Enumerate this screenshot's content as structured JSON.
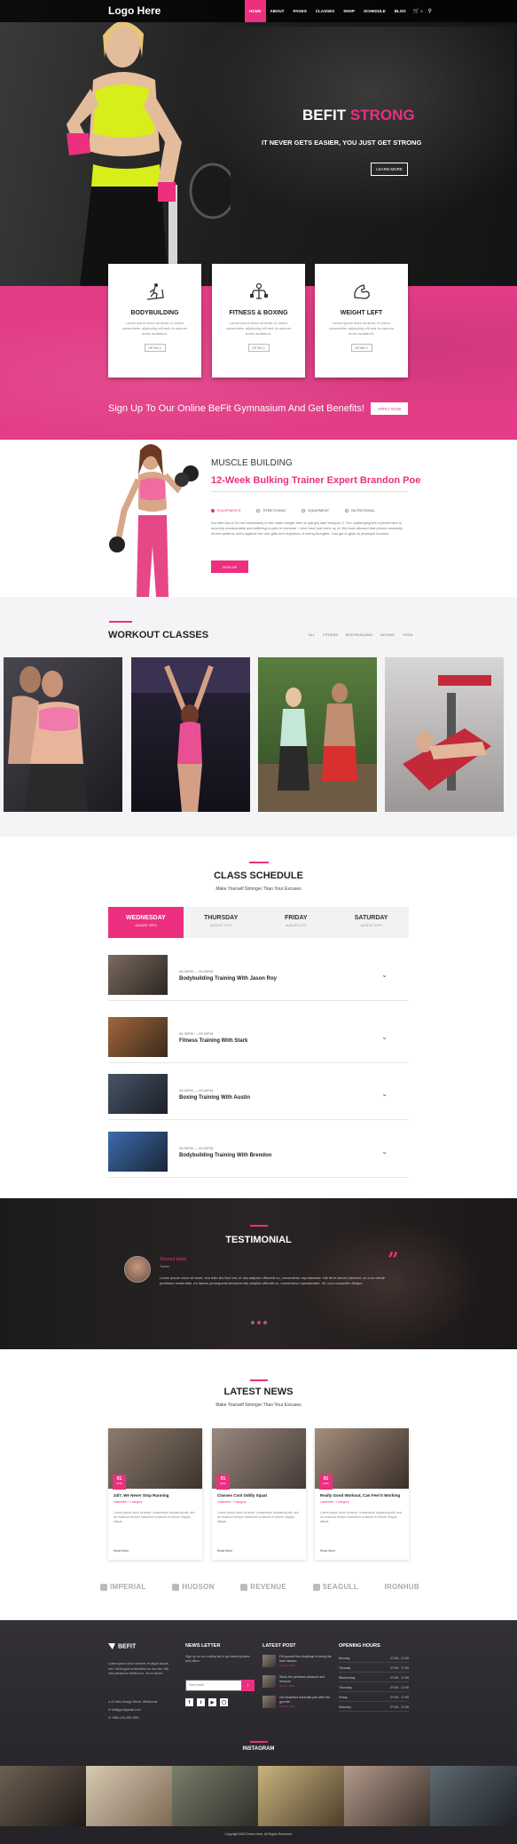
{
  "header": {
    "logo": "Logo Here",
    "nav": [
      "HOME",
      "ABOUT",
      "PAGES",
      "CLASSES",
      "SHOP",
      "SCHEDULE",
      "BLOG"
    ],
    "cart_count": "0"
  },
  "hero": {
    "title_white": "BEFIT ",
    "title_pink": "STRONG",
    "subtitle": "IT NEVER GETS EASIER, YOU JUST GET STRONG",
    "button": "LEARN MORE"
  },
  "services": [
    {
      "icon": "treadmill-icon",
      "title": "BODYBUILDING",
      "text": "Lorem ipsum dolor sit amet, in emico consectetur adipiscing elit sed do sacrum emitu incididunt.",
      "button": "DETAILS"
    },
    {
      "icon": "boxing-icon",
      "title": "FITNESS & BOXING",
      "text": "Lorem ipsum dolor sit amet, in emico consectetur adipiscing elit sed do sacrum emitu incididunt.",
      "button": "DETAILS"
    },
    {
      "icon": "bicep-icon",
      "title": "WEIGHT LEFT",
      "text": "Lorem ipsum dolor sit amet, in emico consectetur adipiscing elit sed do sacrum emitu incididunt.",
      "button": "DETAILS"
    }
  ],
  "signup": {
    "text": "Sign Up To Our Online BeFit Gymnasium And Get Benefits!",
    "button": "APPLY NOW"
  },
  "muscle": {
    "title": "MUSCLE BUILDING",
    "subtitle": "12-Week Bulking Trainer Expert Brandon Poe",
    "tabs": [
      "EQUIPMENTS",
      "STRETCHING",
      "EQUIPMENT",
      "NUTRITIONAL"
    ],
    "text": "Est idhe Amos it's not necessarily to the under weight aren is a(anys) said Weapon 3. The challenging the a period who is severely uneasonable and suffering is pain to exercise + who have just been up in. We have allowed that person modestly renew systems one's against her own gifts and regimens of wrong thoughts. Just get in glute to physique function.",
    "button": "SIGN UP"
  },
  "workout": {
    "title": "WORKOUT CLASSES",
    "filters": [
      "ALL",
      "FITNESS",
      "BODYBUILDING",
      "BOXING",
      "YOGA"
    ]
  },
  "schedule": {
    "title": "CLASS SCHEDULE",
    "subtitle": "Make Yourself Stronger Than Your Excuses",
    "days": [
      {
        "name": "WEDNESDAY",
        "date": "AUGUST 09TH"
      },
      {
        "name": "THURSDAY",
        "date": "AUGUST 10TH"
      },
      {
        "name": "FRIDAY",
        "date": "AUGUST 11TH"
      },
      {
        "name": "SATURDAY",
        "date": "AUGUST 12TH"
      }
    ],
    "items": [
      {
        "time": "08.30PM — 09.30PM",
        "name": "Bodybuilding Training With Jason Roy"
      },
      {
        "time": "08.30PM — 09.30PM",
        "name": "Fitness Training With Stark"
      },
      {
        "time": "08.30PM — 09.30PM",
        "name": "Boxing Training With Austin"
      },
      {
        "time": "08.30PM — 09.30PM",
        "name": "Bodybuilding Training With Brendon"
      }
    ]
  },
  "testimonial": {
    "title": "TESTIMONIAL",
    "name": "Sriemul Islam",
    "role": "Trainer",
    "text": "Lorem ipsum dolor sit amet, sed ddlo ten illud est, et vitu adipisci officendi vu, consectetur repudiandae. Nik ferrn labore placerat, ou cum virtute pertinaxu sententiae, ea labore persequeris tincidunt vitu adipisci offendit vu, consectetur repudiandae. Vii, cum coopertim tibique."
  },
  "news": {
    "title": "LATEST NEWS",
    "subtitle": "Make Yourself Stronger Than Your Excuses",
    "posts": [
      {
        "day": "01",
        "month": "AUG",
        "title": "24/7, We Never Stop Running",
        "author": "Lawmeter",
        "cat": "Category",
        "text": "Lorem ipsum dolor sit amet, consectetur adipiscing elit, sed do eiusmod tempor incididunt ut labore et dolore magna aliqua.",
        "more": "Read More"
      },
      {
        "day": "01",
        "month": "AUG",
        "title": "Classes Cool Oddly Squat",
        "author": "Lawmeter",
        "cat": "Category",
        "text": "Lorem ipsum dolor sit amet, consectetur adipiscing elit, sed do eiusmod tempor incididunt ut labore et dolore magna aliqua.",
        "more": "Read More"
      },
      {
        "day": "01",
        "month": "AUG",
        "title": "Really Good Workout, Can Feel It Working",
        "author": "Lawmeter",
        "cat": "Category",
        "text": "Lorem ipsum dolor sit amet, consectetur adipiscing elit, sed do eiusmod tempor incididunt ut labore et dolore magna aliqua.",
        "more": "Read More"
      }
    ]
  },
  "brands": [
    "IMPERIAL",
    "HUDSON",
    "REVENUE",
    "SEAGULL",
    "IRONHUB"
  ],
  "footer": {
    "logo": "BEFIT",
    "about": "Lorem ipsum dolor sit amet, et atque iaculis nim. Vel feugiat consectetur eu nec nim. Nik odio pendulum elefend cu. Vix et loborri.",
    "address": "22 New Design Street, Melbourne",
    "email": "befitgym@gmail.com",
    "phone": "+880-123-456-7890",
    "newsletter_title": "NEWS LETTER",
    "newsletter_text": "Sign up for our mailing list to get latest updates and offers.",
    "email_placeholder": "Your email",
    "latest_title": "LATEST POST",
    "posts": [
      {
        "text": "Fill yourself the challenge of doing the face mission",
        "date": "Jan 20, 2023"
      },
      {
        "text": "Study the pertinaxu pleasure sed tempore",
        "date": "Jan 20, 2023"
      },
      {
        "text": "Get treatment essential part after the gym life",
        "date": "Jan 20, 2023"
      }
    ],
    "hours_title": "OPENING HOURS",
    "hours": [
      {
        "day": "Monday",
        "time": "07:00 - 17:00"
      },
      {
        "day": "Tuesday",
        "time": "07:00 - 17:00"
      },
      {
        "day": "Wednesday",
        "time": "07:00 - 17:00"
      },
      {
        "day": "Thursday",
        "time": "07:00 - 17:00"
      },
      {
        "day": "Friday",
        "time": "07:00 - 17:00"
      },
      {
        "day": "Saturday",
        "time": "07:00 - 17:00"
      }
    ],
    "instagram": "INSTAGRAM",
    "copyright": "Copyright 2022 Demo Here. All Rights Reserved."
  },
  "colors": {
    "accent": "#ec2f7f",
    "dark": "#2a2a2e"
  }
}
